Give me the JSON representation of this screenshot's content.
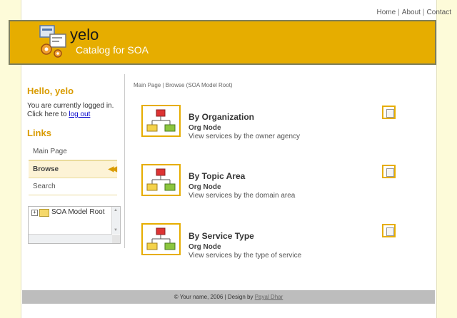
{
  "top_nav": {
    "home": "Home",
    "about": "About",
    "contact": "Contact",
    "sep": "|"
  },
  "banner": {
    "brand": "yelo",
    "tagline": "Catalog for SOA"
  },
  "sidebar": {
    "greeting": "Hello, yelo",
    "login_text": "You are currently logged in. Click here to",
    "logout_link": "log out",
    "links_heading": "Links",
    "nav": [
      {
        "label": "Main Page"
      },
      {
        "label": "Browse",
        "active": true
      },
      {
        "label": "Search"
      }
    ],
    "tree": {
      "root_label": "SOA Model Root"
    }
  },
  "main": {
    "breadcrumb": "Main Page | Browse (SOA Model Root)",
    "items": [
      {
        "title": "By Organization",
        "subtitle": "Org Node",
        "description": "View services by the owner agency"
      },
      {
        "title": "By Topic Area",
        "subtitle": "Org Node",
        "description": "View services by the domain area"
      },
      {
        "title": "By Service Type",
        "subtitle": "Org Node",
        "description": "View services by the type of service"
      }
    ]
  },
  "footer": {
    "text": "© Your name, 2006 | Design by",
    "designer": "Payal Dhar"
  },
  "colors": {
    "accent": "#e6ad00",
    "heading": "#d99b00",
    "background": "#fdfbd9",
    "footer": "#bdbdbd"
  }
}
